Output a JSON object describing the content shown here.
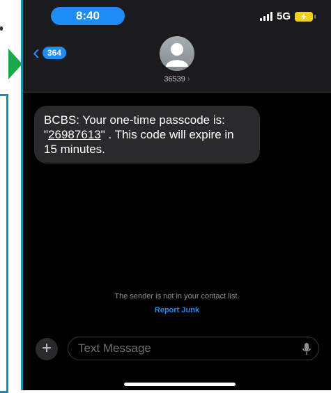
{
  "status": {
    "time": "8:40",
    "network": "5G"
  },
  "nav": {
    "back_count": "364",
    "contact": "36539"
  },
  "message": {
    "text_prefix": "BCBS: Your one-time passcode is: \"",
    "code": "26987613",
    "text_suffix": "\" . This code will expire in 15 minutes."
  },
  "notice": {
    "text": "The sender is not in your contact list.",
    "report": "Report Junk"
  },
  "composer": {
    "placeholder": "Text Message",
    "plus": "+"
  },
  "colors": {
    "accent": "#1e8df5",
    "bubble": "#2a2a2c",
    "battery": "#f4d01e"
  },
  "icons": [
    "back-chevron-icon",
    "signal-icon",
    "battery-charging-icon",
    "avatar-icon",
    "plus-icon",
    "microphone-icon"
  ]
}
